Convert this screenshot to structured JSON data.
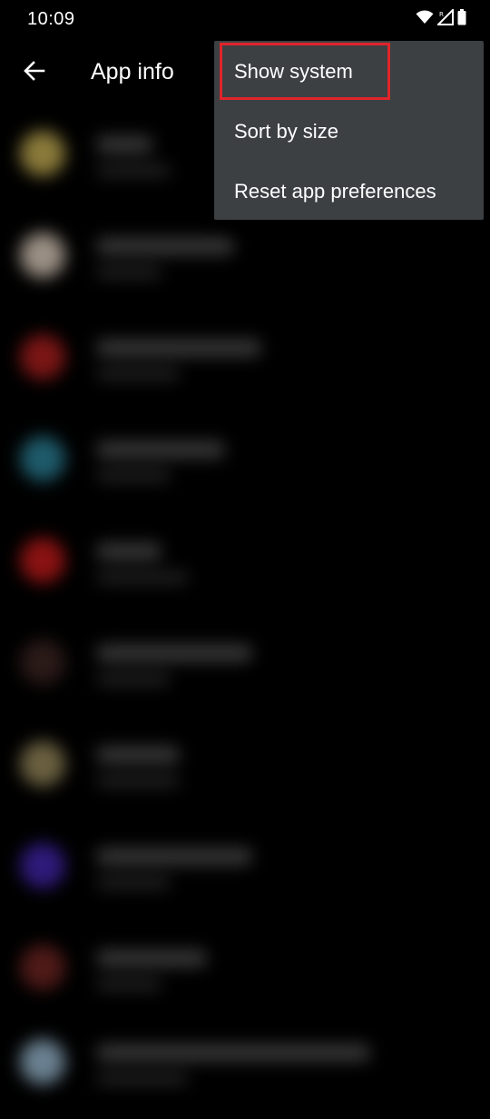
{
  "status_bar": {
    "time": "10:09",
    "icons": [
      "wifi-icon",
      "signal-icon",
      "battery-icon"
    ]
  },
  "app_bar": {
    "back_icon": "arrow-back-icon",
    "title": "App info"
  },
  "overflow_menu": {
    "items": [
      {
        "label": "Show system"
      },
      {
        "label": "Sort by size"
      },
      {
        "label": "Reset app preferences"
      }
    ],
    "highlighted_item": "Show system",
    "highlight_color": "#e0242b",
    "background_color": "#3c4043"
  },
  "app_list": {
    "blurred": true,
    "icon_colors": [
      "#8a7a3a",
      "#9a8f84",
      "#7a1515",
      "#1e5a6a",
      "#8a1212",
      "#2a1a18",
      "#6a6040",
      "#2e1a7a",
      "#4e1a18",
      "#6a8090"
    ]
  }
}
